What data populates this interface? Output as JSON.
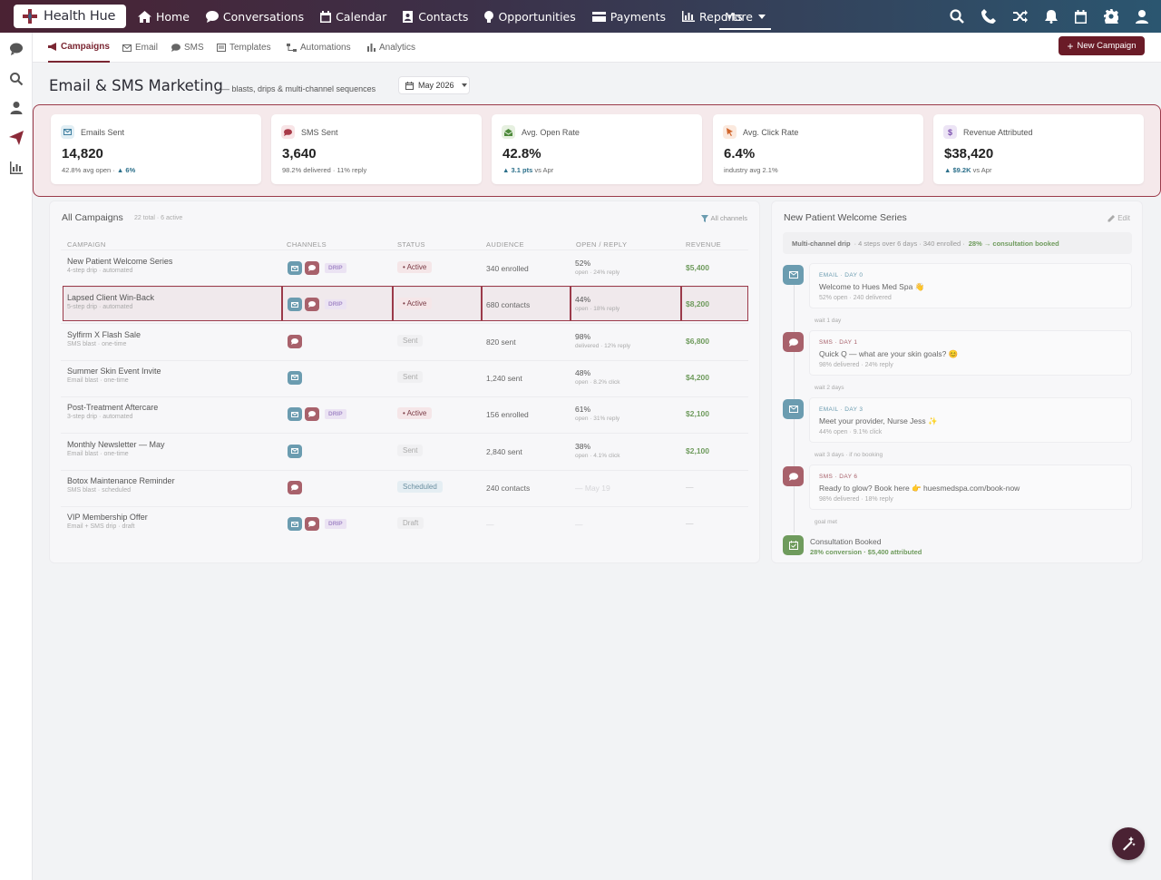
{
  "app": {
    "name": "Health Hue"
  },
  "nav": {
    "items": [
      {
        "label": "Home",
        "icon": "home-icon"
      },
      {
        "label": "Conversations",
        "icon": "chat-icon"
      },
      {
        "label": "Calendar",
        "icon": "calendar-icon"
      },
      {
        "label": "Contacts",
        "icon": "contacts-icon"
      },
      {
        "label": "Opportunities",
        "icon": "lightbulb-icon"
      },
      {
        "label": "Payments",
        "icon": "credit-card-icon"
      },
      {
        "label": "Reports",
        "icon": "bar-chart-icon"
      }
    ],
    "more_label": "More"
  },
  "top_icons": [
    "search-icon",
    "phone-icon",
    "shuffle-icon",
    "bell-icon",
    "calendar-icon",
    "gear-icon",
    "user-icon"
  ],
  "sidebar": [
    "chat-icon",
    "search-icon",
    "user-icon",
    "send-icon",
    "chart-icon"
  ],
  "subnav": {
    "items": [
      {
        "label": "Campaigns",
        "active": true
      },
      {
        "label": "Email"
      },
      {
        "label": "SMS"
      },
      {
        "label": "Templates"
      },
      {
        "label": "Automations"
      },
      {
        "label": "Analytics"
      }
    ],
    "new_campaign_label": "New Campaign"
  },
  "page": {
    "title": "Email & SMS Marketing",
    "subtitle": "— blasts, drips & multi-channel sequences",
    "month": "May 2026"
  },
  "kpis": [
    {
      "label": "Emails Sent",
      "value": "14,820",
      "sub": "42.8% avg open · ",
      "delta": "▲ 6%",
      "tail": "",
      "color": "#e1eef4",
      "icon": "envelope-icon"
    },
    {
      "label": "SMS Sent",
      "value": "3,640",
      "sub": "98.2% delivered · 11% reply",
      "delta": "",
      "tail": "",
      "color": "#f8e4e6",
      "icon": "message-icon"
    },
    {
      "label": "Avg. Open Rate",
      "value": "42.8%",
      "sub": "",
      "delta": "▲ 3.1 pts",
      "tail": " vs Apr",
      "color": "#e6f0e0",
      "icon": "envelope-open-icon"
    },
    {
      "label": "Avg. Click Rate",
      "value": "6.4%",
      "sub": "industry avg 2.1%",
      "delta": "",
      "tail": "",
      "color": "#fbe9de",
      "icon": "pointer-icon"
    },
    {
      "label": "Revenue Attributed",
      "value": "$38,420",
      "sub": "",
      "delta": "▲ $9.2K",
      "tail": " vs Apr",
      "color": "#ece4f5",
      "icon": "dollar-icon"
    }
  ],
  "campaigns": {
    "title": "All Campaigns",
    "meta": "22 total · 6 active",
    "filter": "All channels",
    "columns": [
      "CAMPAIGN",
      "CHANNELS",
      "STATUS",
      "AUDIENCE",
      "OPEN / REPLY",
      "REVENUE"
    ],
    "rows": [
      {
        "name": "New Patient Welcome Series",
        "desc": "4-step drip · automated",
        "channels": [
          "email",
          "sms"
        ],
        "drip": "DRIP",
        "status": "• Active",
        "status_type": "active",
        "audience": "340 enrolled",
        "open": "52%",
        "open_sub": "open · 24% reply",
        "revenue": "$5,400"
      },
      {
        "name": "Lapsed Client Win-Back",
        "desc": "5-step drip · automated",
        "channels": [
          "email",
          "sms"
        ],
        "drip": "DRIP",
        "status": "• Active",
        "status_type": "active",
        "audience": "680 contacts",
        "open": "44%",
        "open_sub": "open · 18% reply",
        "revenue": "$8,200",
        "highlight": true
      },
      {
        "name": "Sylfirm X Flash Sale",
        "desc": "SMS blast · one-time",
        "channels": [
          "sms"
        ],
        "drip": "",
        "status": "Sent",
        "status_type": "sent",
        "audience": "820 sent",
        "open": "98%",
        "open_sub": "delivered · 12% reply",
        "revenue": "$6,800"
      },
      {
        "name": "Summer Skin Event Invite",
        "desc": "Email blast · one-time",
        "channels": [
          "email"
        ],
        "drip": "",
        "status": "Sent",
        "status_type": "sent",
        "audience": "1,240 sent",
        "open": "48%",
        "open_sub": "open · 8.2% click",
        "revenue": "$4,200"
      },
      {
        "name": "Post-Treatment Aftercare",
        "desc": "3-step drip · automated",
        "channels": [
          "email",
          "sms"
        ],
        "drip": "DRIP",
        "status": "• Active",
        "status_type": "active",
        "audience": "156 enrolled",
        "open": "61%",
        "open_sub": "open · 31% reply",
        "revenue": "$2,100"
      },
      {
        "name": "Monthly Newsletter — May",
        "desc": "Email blast · one-time",
        "channels": [
          "email"
        ],
        "drip": "",
        "status": "Sent",
        "status_type": "sent",
        "audience": "2,840 sent",
        "open": "38%",
        "open_sub": "open · 4.1% click",
        "revenue": "$2,100"
      },
      {
        "name": "Botox Maintenance Reminder",
        "desc": "SMS blast · scheduled",
        "channels": [
          "sms"
        ],
        "drip": "",
        "status": "Scheduled",
        "status_type": "sched",
        "audience": "240 contacts",
        "open": "— May 19",
        "open_sub": "",
        "revenue": "—"
      },
      {
        "name": "VIP Membership Offer",
        "desc": "Email + SMS drip · draft",
        "channels": [
          "email",
          "sms"
        ],
        "drip": "DRIP",
        "status": "Draft",
        "status_type": "draft",
        "audience": "—",
        "open": "—",
        "open_sub": "",
        "revenue": "—"
      }
    ]
  },
  "sequence": {
    "title": "New Patient Welcome Series",
    "edit_label": "Edit",
    "summary_label": "Multi-channel drip",
    "summary_meta": "· 4 steps over 6 days · 340 enrolled ·",
    "summary_result": "28% → consultation booked",
    "steps": [
      {
        "type": "email",
        "label": "EMAIL · DAY 0",
        "title": "Welcome to Hues Med Spa 👋",
        "meta": "52% open · 240 delivered",
        "wait_after": "wait 1 day"
      },
      {
        "type": "sms",
        "label": "SMS · DAY 1",
        "title": "Quick Q — what are your skin goals? 😊",
        "meta": "98% delivered · 24% reply",
        "wait_after": "wait 2 days"
      },
      {
        "type": "email",
        "label": "EMAIL · DAY 3",
        "title": "Meet your provider, Nurse Jess ✨",
        "meta": "44% open · 9.1% click",
        "wait_after": "wait 3 days · if no booking"
      },
      {
        "type": "sms",
        "label": "SMS · DAY 6",
        "title": "Ready to glow? Book here 👉 huesmedspa.com/book-now",
        "meta": "98% delivered · 18% reply",
        "wait_after": "goal met"
      }
    ],
    "final_title": "Consultation Booked",
    "final_sub": "28% conversion · $5,400 attributed"
  }
}
